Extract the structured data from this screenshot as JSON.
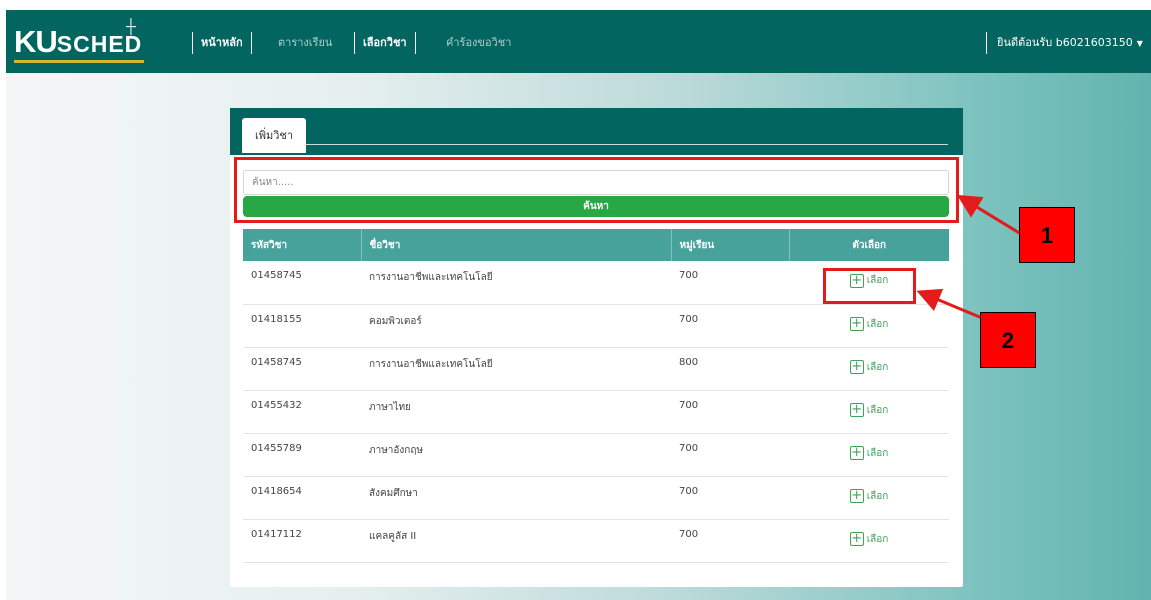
{
  "navbar": {
    "logo_main": "KU",
    "logo_sub": "SCHED",
    "items": [
      {
        "label": "หน้าหลัก",
        "active": true
      },
      {
        "label": "ตารางเรียน",
        "active": false
      },
      {
        "label": "เลือกวิชา",
        "active": true
      },
      {
        "label": "คำร้องขอวิชา",
        "active": false
      }
    ],
    "user_greeting": "ยินดีต้อนรับ b6021603150"
  },
  "card": {
    "tab_label": "เพิ่มวิชา",
    "search_placeholder": "ค้นหา.....",
    "search_button": "ค้นหา"
  },
  "table": {
    "headers": [
      "รหัสวิชา",
      "ชื่อวิชา",
      "หมู่เรียน",
      "ตัวเลือก"
    ],
    "select_label": "เลือก",
    "rows": [
      {
        "code": "01458745",
        "name": "การงานอาชีพและเทคโนโลยี",
        "section": "700"
      },
      {
        "code": "01418155",
        "name": "คอมพิวเตอร์",
        "section": "700"
      },
      {
        "code": "01458745",
        "name": "การงานอาชีพและเทคโนโลยี",
        "section": "800"
      },
      {
        "code": "01455432",
        "name": "ภาษาไทย",
        "section": "700"
      },
      {
        "code": "01455789",
        "name": "ภาษาอังกฤษ",
        "section": "700"
      },
      {
        "code": "01418654",
        "name": "สังคมศึกษา",
        "section": "700"
      },
      {
        "code": "01417112",
        "name": "แคลคูลัส II",
        "section": "700"
      }
    ]
  },
  "annotations": [
    "1",
    "2"
  ],
  "colors": {
    "nav_bg": "#03655f",
    "table_header": "#47a29c",
    "search_button": "#28a745",
    "annotation": "#ff0000"
  }
}
